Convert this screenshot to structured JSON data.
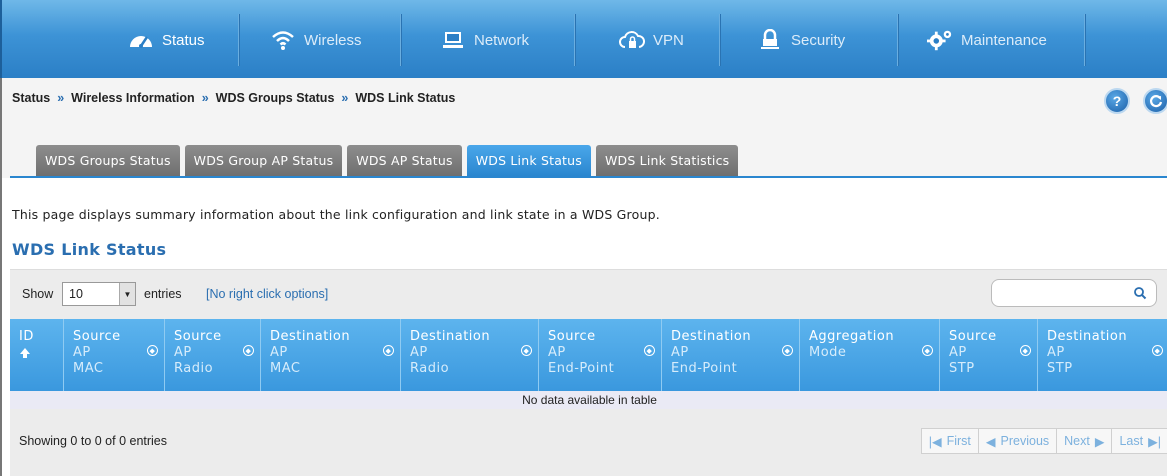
{
  "nav": {
    "items": [
      {
        "label": "Status",
        "icon": "dashboard-icon",
        "active": true
      },
      {
        "label": "Wireless",
        "icon": "wifi-icon",
        "active": false
      },
      {
        "label": "Network",
        "icon": "monitor-icon",
        "active": false
      },
      {
        "label": "VPN",
        "icon": "cloud-lock-icon",
        "active": false
      },
      {
        "label": "Security",
        "icon": "lock-icon",
        "active": false
      },
      {
        "label": "Maintenance",
        "icon": "gears-icon",
        "active": false
      }
    ]
  },
  "breadcrumb": [
    "Status",
    "Wireless Information",
    "WDS Groups Status",
    "WDS Link Status"
  ],
  "breadcrumb_sep": "»",
  "help_label": "?",
  "tabs": [
    {
      "label": "WDS Groups Status",
      "active": false
    },
    {
      "label": "WDS Group AP Status",
      "active": false
    },
    {
      "label": "WDS AP Status",
      "active": false
    },
    {
      "label": "WDS Link Status",
      "active": true
    },
    {
      "label": "WDS Link Statistics",
      "active": false
    }
  ],
  "description": "This page displays summary information about the link configuration and link state in a WDS Group.",
  "section_title": "WDS Link Status",
  "table_controls": {
    "show_label": "Show",
    "entries_value": "10",
    "entries_label": "entries",
    "right_click_label": "[No right click options]",
    "search_value": ""
  },
  "columns": [
    {
      "lines": [
        "ID"
      ]
    },
    {
      "lines": [
        "Source",
        "AP",
        "MAC"
      ]
    },
    {
      "lines": [
        "Source",
        "AP",
        "Radio"
      ]
    },
    {
      "lines": [
        "Destination",
        "AP",
        "MAC"
      ]
    },
    {
      "lines": [
        "Destination",
        "AP",
        "Radio"
      ]
    },
    {
      "lines": [
        "Source",
        "AP",
        "End-Point"
      ]
    },
    {
      "lines": [
        "Destination",
        "AP",
        "End-Point"
      ]
    },
    {
      "lines": [
        "Aggregation",
        "Mode"
      ]
    },
    {
      "lines": [
        "Source",
        "AP",
        "STP"
      ]
    },
    {
      "lines": [
        "Destination",
        "AP",
        "STP"
      ]
    }
  ],
  "empty_message": "No data available in table",
  "showing_text": "Showing 0 to 0 of 0 entries",
  "pager": {
    "first": "First",
    "previous": "Previous",
    "next": "Next",
    "last": "Last"
  },
  "colors": {
    "accent": "#3a98de",
    "nav": "#2b7fc6"
  }
}
